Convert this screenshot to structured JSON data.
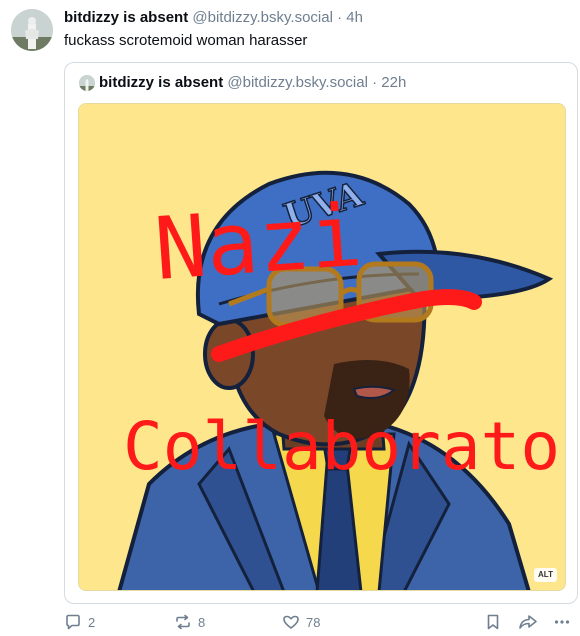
{
  "post": {
    "author_name": "bitdizzy is absent",
    "author_handle": "@bitdizzy.bsky.social",
    "separator": "·",
    "time": "4h",
    "text": "fuckass scrotemoid woman harasser"
  },
  "quote": {
    "author_name": "bitdizzy is absent",
    "author_handle": "@bitdizzy.bsky.social",
    "separator": "·",
    "time": "22h",
    "image": {
      "cap_text": "UVA",
      "overlay_word_1": "Nazi",
      "overlay_word_2": "Collaborator",
      "alt_badge": "ALT",
      "colors": {
        "background": "#fde68c",
        "cap": "#3f6fc4",
        "overlay": "#ff1a1a",
        "suit": "#3d64a8"
      }
    }
  },
  "actions": {
    "reply_count": "2",
    "repost_count": "8",
    "like_count": "78"
  },
  "icons": {
    "reply": "reply-icon",
    "repost": "repost-icon",
    "like": "heart-icon",
    "bookmark": "bookmark-icon",
    "share": "share-icon",
    "more": "more-icon"
  }
}
